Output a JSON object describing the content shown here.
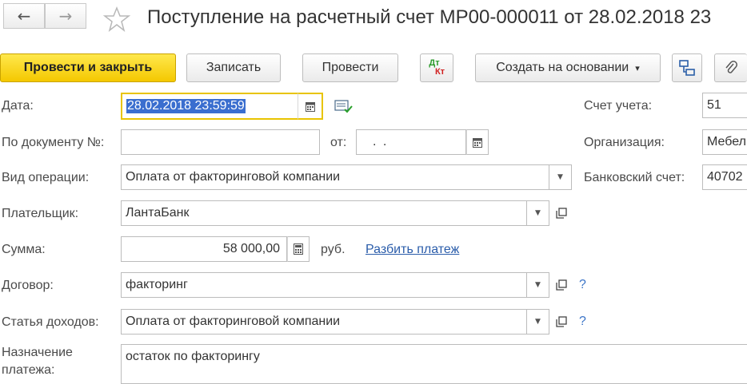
{
  "header": {
    "back_icon": "arrow-left-icon",
    "forward_icon": "arrow-right-icon",
    "favorite_icon": "star-icon",
    "title": "Поступление на расчетный счет МР00-000011 от 28.02.2018 23"
  },
  "toolbar": {
    "post_close": "Провести и закрыть",
    "save": "Записать",
    "post": "Провести",
    "dt_label": "Дт",
    "kt_label": "Кт",
    "create_based": "Создать на основании",
    "create_based_arrow": "▾"
  },
  "form": {
    "date": {
      "label": "Дата:",
      "value": "28.02.2018 23:59:59"
    },
    "doc_number": {
      "label": "По документу №:",
      "value": ""
    },
    "doc_from": {
      "label": "от:",
      "value": ".  ."
    },
    "operation": {
      "label": "Вид операции:",
      "value": "Оплата от факторинговой компании"
    },
    "payer": {
      "label": "Плательщик:",
      "value": "ЛантаБанк"
    },
    "amount": {
      "label": "Сумма:",
      "value": "58 000,00",
      "currency": "руб.",
      "split_link": "Разбить платеж"
    },
    "contract": {
      "label": "Договор:",
      "value": "факторинг",
      "help": "?"
    },
    "income_item": {
      "label": "Статья доходов:",
      "value": "Оплата от факторинговой компании",
      "help": "?"
    },
    "purpose": {
      "label_line1": "Назначение",
      "label_line2": "платежа:",
      "value": "остаток по факторингу"
    },
    "account": {
      "label": "Счет учета:",
      "value": "51"
    },
    "organization": {
      "label": "Организация:",
      "value": "Мебел"
    },
    "bank_account": {
      "label": "Банковский счет:",
      "value": "40702"
    }
  },
  "colors": {
    "primary_button": "#f4c800",
    "link": "#2a5caa",
    "selection": "#3a6ecf",
    "focus_border": "#e8c400"
  }
}
